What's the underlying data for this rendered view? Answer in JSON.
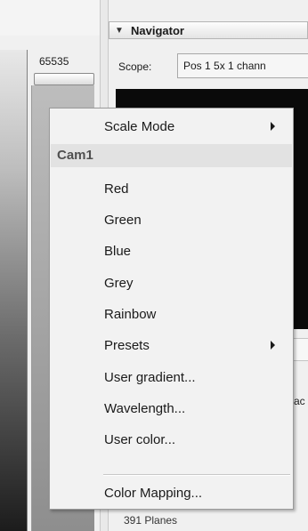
{
  "histogram": {
    "max_value": "65535"
  },
  "navigator": {
    "title": "Navigator",
    "scope_label": "Scope:",
    "scope_value": "Pos 1 5x 1 chann",
    "side_fragment": "ac",
    "planes_label": "391 Planes"
  },
  "context_menu": {
    "group_header": "Cam1",
    "items": [
      {
        "label": "Scale Mode",
        "submenu": true
      },
      {
        "label": "Red"
      },
      {
        "label": "Green"
      },
      {
        "label": "Blue"
      },
      {
        "label": "Grey"
      },
      {
        "label": "Rainbow"
      },
      {
        "label": "Presets",
        "submenu": true
      },
      {
        "label": "User gradient..."
      },
      {
        "label": "Wavelength..."
      },
      {
        "label": "User color..."
      },
      {
        "label": "Color Mapping..."
      }
    ]
  }
}
